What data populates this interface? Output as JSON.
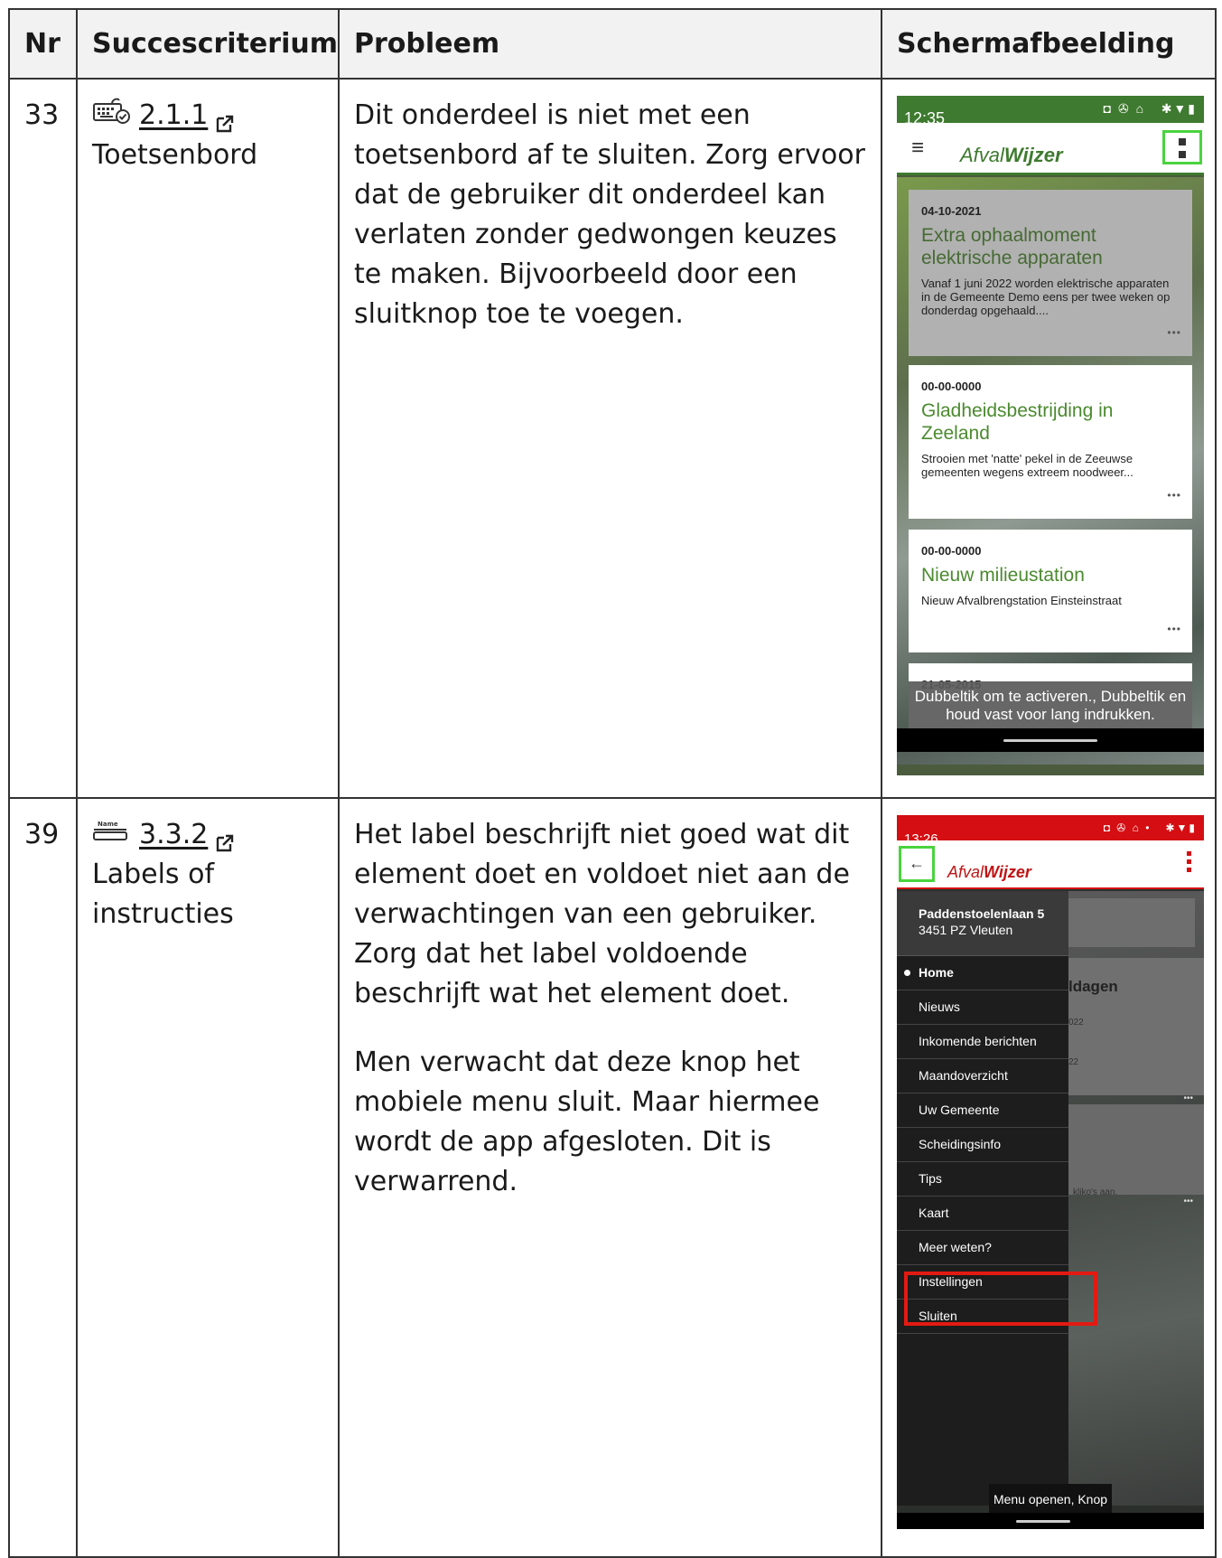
{
  "table": {
    "headers": [
      "Nr",
      "Succescriterium",
      "Probleem",
      "Schermafbeelding"
    ]
  },
  "rows": [
    {
      "nr": "33",
      "criterion_icon": "keyboard-icon",
      "criterion_number": "2.1.1",
      "criterion_name": "Toetsenbord",
      "problem": [
        "Dit onderdeel is niet met een toetsenbord af te sluiten. Zorg ervoor dat de gebruiker dit onderdeel kan verlaten zonder gedwongen keuzes te maken. Bijvoorbeeld door een sluitknop toe te voegen."
      ],
      "screenshot": {
        "status_time": "12:35",
        "app_name_part1": "Afval",
        "app_name_part2": "Wijzer",
        "cards": [
          {
            "date": "04-10-2021",
            "title": "Extra ophaalmoment elektrische apparaten",
            "body": "Vanaf 1 juni 2022 worden elektrische apparaten in de Gemeente Demo eens per twee weken op donderdag opgehaald...."
          },
          {
            "date": "00-00-0000",
            "title": "Gladheidsbestrijding in Zeeland",
            "body": "Strooien met 'natte' pekel in de Zeeuwse gemeenten wegens extreem noodweer..."
          },
          {
            "date": "00-00-0000",
            "title": "Nieuw milieustation",
            "body": "Nieuw Afvalbrengstation Einsteinstraat"
          },
          {
            "date": "21-05-2015"
          }
        ],
        "more_label": "•••",
        "toast": "Dubbeltik om te activeren., Dubbeltik en houd vast voor lang indrukken."
      }
    },
    {
      "nr": "39",
      "criterion_icon": "name-label-icon",
      "criterion_icon_text": "Name",
      "criterion_number": "3.3.2",
      "criterion_name": "Labels of instructies",
      "problem": [
        "Het label beschrijft niet goed wat dit element doet en voldoet niet aan de verwachtingen van een gebruiker. Zorg dat het label voldoende beschrijft wat het element doet.",
        "Men verwacht dat deze knop het mobiele menu sluit. Maar hiermee wordt de app afgesloten. Dit is verwarrend."
      ],
      "screenshot": {
        "status_time": "13:26",
        "app_name_part1": "Afval",
        "app_name_part2": "Wijzer",
        "back_arrow": "←",
        "address_line1": "Paddenstoelenlaan 5",
        "address_line2": "3451 PZ Vleuten",
        "menu_items": [
          "Home",
          "Nieuws",
          "Inkomende berichten",
          "Maandoverzicht",
          "Uw Gemeente",
          "Scheidingsinfo",
          "Tips",
          "Kaart",
          "Meer weten?",
          "Instellingen",
          "Sluiten"
        ],
        "bg_heading_fragment": "ldagen",
        "bg_fragment_1": "022",
        "bg_fragment_2": "22",
        "bg_fragment_3": "kliko's aan.",
        "more_label": "•••",
        "tooltip": "Menu openen, Knop"
      }
    }
  ],
  "colors": {
    "green_status": "#3e7a2f",
    "red_status": "#d40e12",
    "focus_green": "#4ad33e",
    "highlight_red": "#e31a12"
  }
}
